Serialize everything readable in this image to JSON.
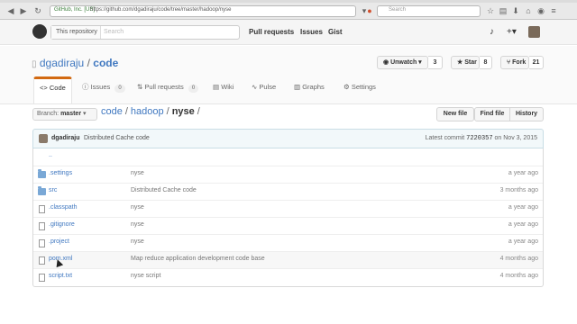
{
  "browser": {
    "site_label": "GitHub, Inc. [US]",
    "url": "https://github.com/dgadiraju/code/tree/master/hadoop/nyse",
    "search_placeholder": "Search"
  },
  "header": {
    "scope_label": "This repository",
    "search_placeholder": "Search",
    "nav": [
      "Pull requests",
      "Issues",
      "Gist"
    ],
    "bell_icon": "bell-icon",
    "plus_icon": "plus-icon",
    "avatar_icon": "avatar"
  },
  "repo": {
    "owner": "dgadiraju",
    "separator": "/",
    "name": "code",
    "actions": [
      {
        "label": "Unwatch ▾",
        "count": "3",
        "icon": "eye-icon"
      },
      {
        "label": "Star",
        "count": "8",
        "icon": "star-icon"
      },
      {
        "label": "Fork",
        "count": "21",
        "icon": "fork-icon"
      }
    ],
    "tabs": [
      {
        "label": "Code",
        "icon": "code-icon",
        "count": ""
      },
      {
        "label": "Issues",
        "icon": "issue-icon",
        "count": "0"
      },
      {
        "label": "Pull requests",
        "icon": "pull-request-icon",
        "count": "0"
      },
      {
        "label": "Wiki",
        "icon": "wiki-icon",
        "count": ""
      },
      {
        "label": "Pulse",
        "icon": "pulse-icon",
        "count": ""
      },
      {
        "label": "Graphs",
        "icon": "graph-icon",
        "count": ""
      },
      {
        "label": "Settings",
        "icon": "gear-icon",
        "count": ""
      }
    ]
  },
  "file_nav": {
    "branch_prefix": "Branch:",
    "branch": "master",
    "path": [
      "code",
      "hadoop",
      "nyse"
    ],
    "path_trail": "/",
    "buttons": [
      "New file",
      "Find file",
      "History"
    ]
  },
  "commit": {
    "author": "dgadiraju",
    "message": "Distributed Cache code",
    "latest_label": "Latest commit",
    "sha": "7220357",
    "date": "on Nov 3, 2015"
  },
  "files": [
    {
      "name": "..",
      "type": "up",
      "message": "",
      "age": ""
    },
    {
      "name": ".settings",
      "type": "dir",
      "message": "nyse",
      "age": "a year ago"
    },
    {
      "name": "src",
      "type": "dir",
      "message": "Distributed Cache code",
      "age": "3 months ago"
    },
    {
      "name": ".classpath",
      "type": "file",
      "message": "nyse",
      "age": "a year ago"
    },
    {
      "name": ".gitignore",
      "type": "file",
      "message": "nyse",
      "age": "a year ago"
    },
    {
      "name": ".project",
      "type": "file",
      "message": "nyse",
      "age": "a year ago"
    },
    {
      "name": "pom.xml",
      "type": "file",
      "message": "Map reduce application development code base",
      "age": "4 months ago"
    },
    {
      "name": "script.txt",
      "type": "file",
      "message": "nyse script",
      "age": "4 months ago"
    }
  ]
}
